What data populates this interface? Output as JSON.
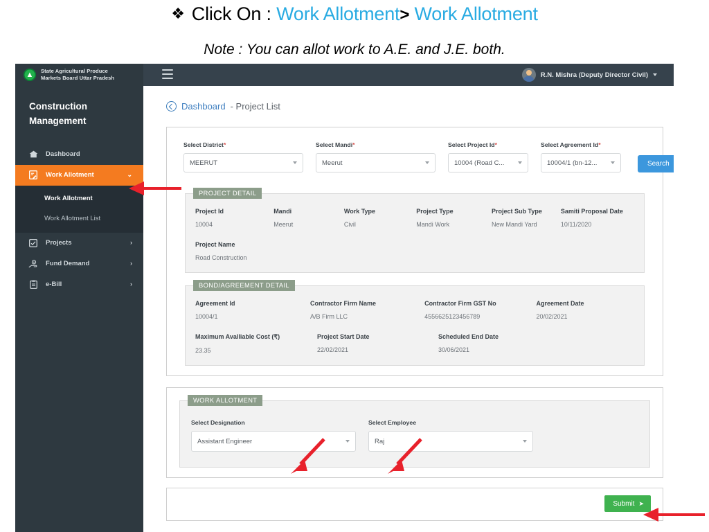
{
  "slide": {
    "instruction_prefix": "Click On : ",
    "instruction_link1": "Work Allotment",
    "instruction_sep": ">",
    "instruction_link2": "Work Allotment",
    "bullet_glyph": "❖",
    "note": "Note : You can allot work to A.E. and J.E. both.",
    "link_color": "#29ABE2"
  },
  "topbar": {
    "brand_line1": "State Agricultural Produce",
    "brand_line2": "Markets Board Uttar Pradesh",
    "logo_glyph": "▲",
    "menu_toggle": "hamburger",
    "user_name": "R.N. Mishra (Deputy Director Civil)"
  },
  "sidebar": {
    "title_line1": "Construction",
    "title_line2": "Management",
    "active_color": "#F47B20",
    "items": [
      {
        "label": "Dashboard",
        "icon": "home-icon",
        "chev": "",
        "active": false
      },
      {
        "label": "Work Allotment",
        "icon": "file-edit-icon",
        "chev": "⌄",
        "active": true
      },
      {
        "label": "Projects",
        "icon": "checkbox-icon",
        "chev": "›",
        "active": false
      },
      {
        "label": "Fund Demand",
        "icon": "hand-money-icon",
        "chev": "›",
        "active": false
      },
      {
        "label": "e-Bill",
        "icon": "clipboard-icon",
        "chev": "›",
        "active": false
      }
    ],
    "submenu": [
      {
        "label": "Work Allotment",
        "current": true
      },
      {
        "label": "Work Allotment List",
        "current": false
      }
    ]
  },
  "breadcrumb": {
    "back_icon": "back-circle-icon",
    "link": "Dashboard",
    "tail": "- Project List"
  },
  "filters": {
    "district": {
      "label": "Select District",
      "required": "*",
      "value": "MEERUT"
    },
    "mandi": {
      "label": "Select Mandi",
      "required": "*",
      "value": "Meerut"
    },
    "project_id": {
      "label": "Select Project Id",
      "required": "*",
      "value": "10004 (Road C..."
    },
    "agreement_id": {
      "label": "Select Agreement Id",
      "required": "*",
      "value": "10004/1 (bn-12..."
    },
    "search_label": "Search"
  },
  "project_detail": {
    "title": "PROJECT DETAIL",
    "fields": [
      {
        "label": "Project Id",
        "value": "10004"
      },
      {
        "label": "Mandi",
        "value": "Meerut"
      },
      {
        "label": "Work Type",
        "value": "Civil"
      },
      {
        "label": "Project Type",
        "value": "Mandi Work"
      },
      {
        "label": "Project Sub Type",
        "value": "New Mandi Yard"
      },
      {
        "label": "Samiti Proposal Date",
        "value": "10/11/2020"
      }
    ],
    "name_field": {
      "label": "Project Name",
      "value": "Road Construction"
    }
  },
  "bond_detail": {
    "title": "BOND/AGREEMENT DETAIL",
    "row1": [
      {
        "label": "Agreement Id",
        "value": "10004/1"
      },
      {
        "label": "Contractor Firm Name",
        "value": "A/B Firm LLC"
      },
      {
        "label": "Contractor Firm GST No",
        "value": "4556625123456789"
      },
      {
        "label": "Agreement Date",
        "value": "20/02/2021"
      }
    ],
    "row2": [
      {
        "label": "Maximum Avalliable Cost (₹)",
        "value": "23.35"
      },
      {
        "label": "Project Start Date",
        "value": "22/02/2021"
      },
      {
        "label": "Scheduled End Date",
        "value": "30/06/2021"
      }
    ]
  },
  "work_allotment": {
    "title": "WORK ALLOTMENT",
    "designation": {
      "label": "Select Designation",
      "value": "Assistant Engineer"
    },
    "employee": {
      "label": "Select Employee",
      "value": "Raj"
    }
  },
  "submit": {
    "label": "Submit",
    "arrow_glyph": "➤",
    "color": "#3FB24F"
  },
  "annotations": {
    "color": "#E8212B",
    "arrows": [
      {
        "name": "arrow-to-sidebar-work-allotment",
        "direction": "left"
      },
      {
        "name": "arrow-to-designation-select",
        "direction": "down-left"
      },
      {
        "name": "arrow-to-employee-select",
        "direction": "down-left"
      },
      {
        "name": "arrow-to-submit-button",
        "direction": "left"
      }
    ]
  }
}
